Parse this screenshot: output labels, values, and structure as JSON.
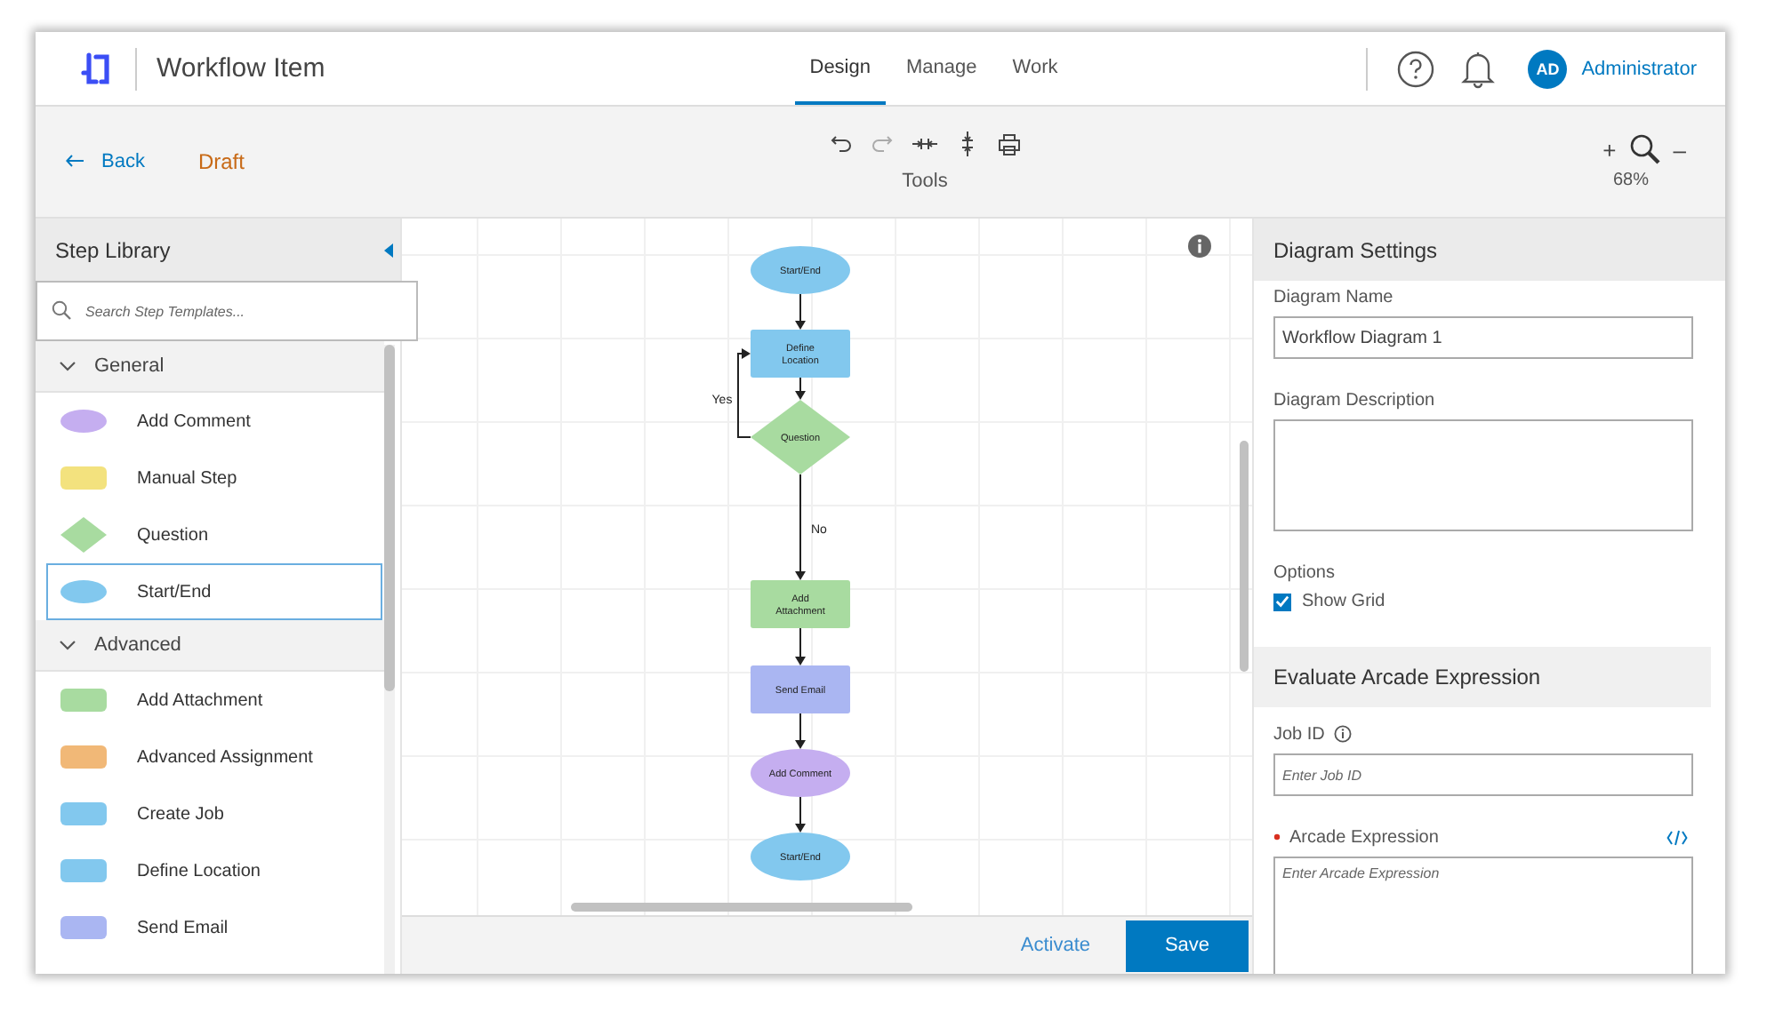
{
  "header": {
    "title": "Workflow Item",
    "tabs": [
      {
        "label": "Design",
        "selected": true
      },
      {
        "label": "Manage",
        "selected": false
      },
      {
        "label": "Work",
        "selected": false
      }
    ],
    "user": {
      "initials": "AD",
      "name": "Administrator"
    }
  },
  "toolbar": {
    "back": "Back",
    "status": "Draft",
    "tools_label": "Tools",
    "zoom_in": "+",
    "zoom_out": "–",
    "zoom": "68%"
  },
  "step_library": {
    "title": "Step Library",
    "search": {
      "placeholder": "Search Step Templates..."
    },
    "groups": [
      {
        "label": "General",
        "expanded": true,
        "items": [
          {
            "label": "Add Comment",
            "kind": "ellipse",
            "color": "#c5aef0",
            "selected": false
          },
          {
            "label": "Manual Step",
            "kind": "rect",
            "color": "#f3e27e",
            "selected": false
          },
          {
            "label": "Question",
            "kind": "diamond",
            "color": "#a8dba0",
            "selected": false
          },
          {
            "label": "Start/End",
            "kind": "ellipse",
            "color": "#82c8ee",
            "selected": true
          }
        ]
      },
      {
        "label": "Advanced",
        "expanded": true,
        "items": [
          {
            "label": "Add Attachment",
            "kind": "rect",
            "color": "#a8dba0",
            "selected": false
          },
          {
            "label": "Advanced Assignment",
            "kind": "rect",
            "color": "#f1b877",
            "selected": false
          },
          {
            "label": "Create Job",
            "kind": "rect",
            "color": "#82c8ee",
            "selected": false
          },
          {
            "label": "Define Location",
            "kind": "rect",
            "color": "#82c8ee",
            "selected": false
          },
          {
            "label": "Send Email",
            "kind": "rect",
            "color": "#aab6f2",
            "selected": false
          }
        ]
      }
    ]
  },
  "diagram": {
    "nodes": [
      {
        "label": "Start/End",
        "kind": "ellipse",
        "color": "#82c8ee"
      },
      {
        "label": "Define Location",
        "kind": "rect",
        "color": "#82c8ee"
      },
      {
        "label": "Question",
        "kind": "diamond",
        "color": "#a8dba0"
      },
      {
        "label": "Add Attachment",
        "kind": "rect",
        "color": "#a8dba0"
      },
      {
        "label": "Send Email",
        "kind": "rect",
        "color": "#aab6f2"
      },
      {
        "label": "Add Comment",
        "kind": "ellipse",
        "color": "#c5aef0"
      },
      {
        "label": "Start/End",
        "kind": "ellipse",
        "color": "#82c8ee"
      }
    ],
    "edge_labels": [
      "Yes",
      "No"
    ]
  },
  "footer": {
    "activate": "Activate",
    "save": "Save"
  },
  "settings": {
    "title": "Diagram Settings",
    "diagram_name": {
      "label": "Diagram Name",
      "value": "Workflow Diagram 1"
    },
    "diagram_description": {
      "label": "Diagram Description"
    },
    "options_label": "Options",
    "show_grid": {
      "label": "Show Grid",
      "checked": true
    },
    "arcade": {
      "title": "Evaluate Arcade Expression",
      "job_id": {
        "label": "Job ID",
        "placeholder": "Enter Job ID"
      },
      "expression": {
        "label": "Arcade Expression",
        "required": true,
        "placeholder": "Enter Arcade Expression"
      }
    }
  }
}
